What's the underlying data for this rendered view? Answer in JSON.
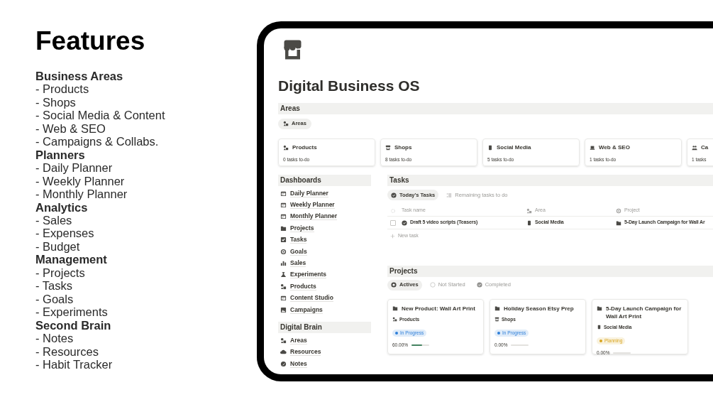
{
  "features": {
    "title": "Features",
    "groups": [
      {
        "heading": "Business Areas",
        "items": [
          "- Products",
          "- Shops",
          "- Social Media & Content",
          "- Web & SEO",
          "- Campaigns & Collabs."
        ]
      },
      {
        "heading": "Planners",
        "items": [
          "- Daily Planner",
          "- Weekly Planner",
          "- Monthly Planner"
        ]
      },
      {
        "heading": "Analytics",
        "items": [
          "- Sales",
          "- Expenses",
          "- Budget"
        ]
      },
      {
        "heading": "Management",
        "items": [
          "- Projects",
          "- Tasks",
          "- Goals",
          "- Experiments"
        ]
      },
      {
        "heading": "Second Brain",
        "items": [
          "- Notes",
          "- Resources",
          "- Habit Tracker"
        ]
      }
    ]
  },
  "page": {
    "title": "Digital Business OS",
    "areas": {
      "heading": "Areas",
      "view_tab": "Areas",
      "cards": [
        {
          "title": "Products",
          "subtitle": "0 tasks to-do"
        },
        {
          "title": "Shops",
          "subtitle": "8 tasks to-do"
        },
        {
          "title": "Social Media",
          "subtitle": "5 tasks to-do"
        },
        {
          "title": "Web & SEO",
          "subtitle": "1 tasks to-do"
        },
        {
          "title": "Ca",
          "subtitle": "1 tasks"
        }
      ]
    },
    "dashboards": {
      "heading": "Dashboards",
      "items": [
        "Daily Planner",
        "Weekly Planner",
        "Monthly Planner",
        "Projects",
        "Tasks",
        "Goals",
        "Sales",
        "Experiments",
        "Products",
        "Content Studio",
        "Campaigns"
      ]
    },
    "digital_brain": {
      "heading": "Digital Brain",
      "items": [
        "Areas",
        "Resources",
        "Notes"
      ]
    },
    "tasks": {
      "heading": "Tasks",
      "tabs": [
        {
          "label": "Today's Tasks",
          "selected": true
        },
        {
          "label": "Remaining tasks to do",
          "selected": false
        }
      ],
      "columns": [
        "Task name",
        "Area",
        "Project"
      ],
      "rows": [
        {
          "checked": false,
          "name": "Draft 5 video scripts (Teasers)",
          "area": "Social Media",
          "project": "5-Day Launch Campaign for Wall Ar"
        }
      ],
      "new_row": "New task"
    },
    "projects": {
      "heading": "Projects",
      "tabs": [
        {
          "label": "Actives",
          "selected": true
        },
        {
          "label": "Not Started",
          "selected": false
        },
        {
          "label": "Completed",
          "selected": false
        }
      ],
      "cards": [
        {
          "title": "New Product: Wall Art Print",
          "area": "Products",
          "status": {
            "label": "In Progress",
            "color": "#2e7fd9"
          },
          "progress": "60.00%",
          "level": 0.6
        },
        {
          "title": "Holiday Season Etsy Prep",
          "area": "Shops",
          "status": {
            "label": "In Progress",
            "color": "#2e7fd9"
          },
          "progress": "0.00%",
          "level": 0
        },
        {
          "title": "5-Day Launch Campaign for Wall Art Print",
          "area": "Social Media",
          "status": {
            "label": "Planning",
            "color": "#d9a520"
          },
          "progress": "0.00%",
          "level": 0
        }
      ]
    }
  }
}
